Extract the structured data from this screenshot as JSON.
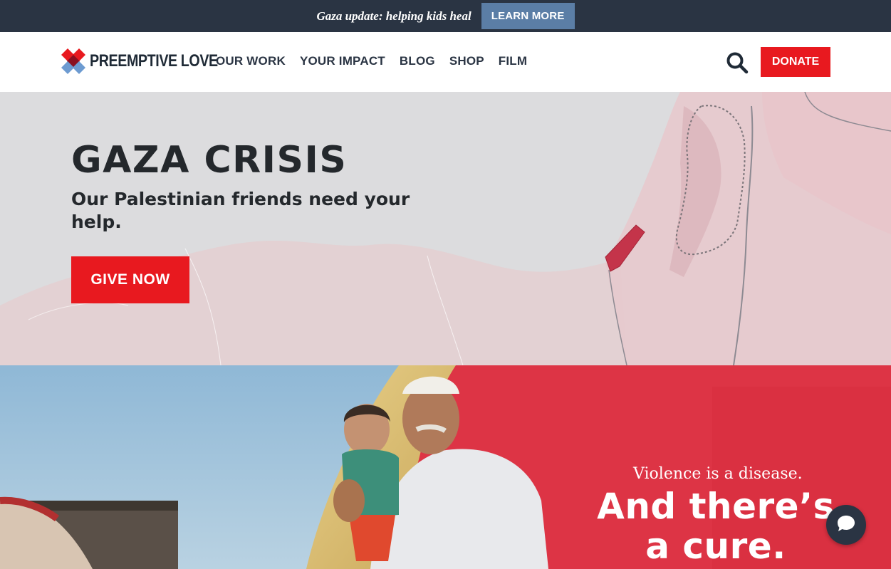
{
  "topbar": {
    "text": "Gaza update: helping kids heal",
    "button_label": "LEARN MORE"
  },
  "header": {
    "logo_text": "PREEMPTIVE LOVE",
    "nav": [
      "OUR WORK",
      "YOUR IMPACT",
      "BLOG",
      "SHOP",
      "FILM"
    ],
    "donate_label": "DONATE",
    "search_icon": "search-icon"
  },
  "hero": {
    "title": "GAZA CRISIS",
    "subtitle": "Our Palestinian friends need your help.",
    "cta_label": "GIVE NOW"
  },
  "photo_section": {
    "tagline_small": "Violence is a disease.",
    "tagline_large": "And there’s a cure."
  },
  "chat": {
    "icon": "chat-bubble-icon"
  },
  "colors": {
    "topbar_bg": "#2a3443",
    "learn_more_bg": "#5b7ea6",
    "accent_red": "#e8191f",
    "hero_bg": "#dcdcde",
    "photo_red": "#dd3445",
    "text_dark": "#24282c"
  }
}
